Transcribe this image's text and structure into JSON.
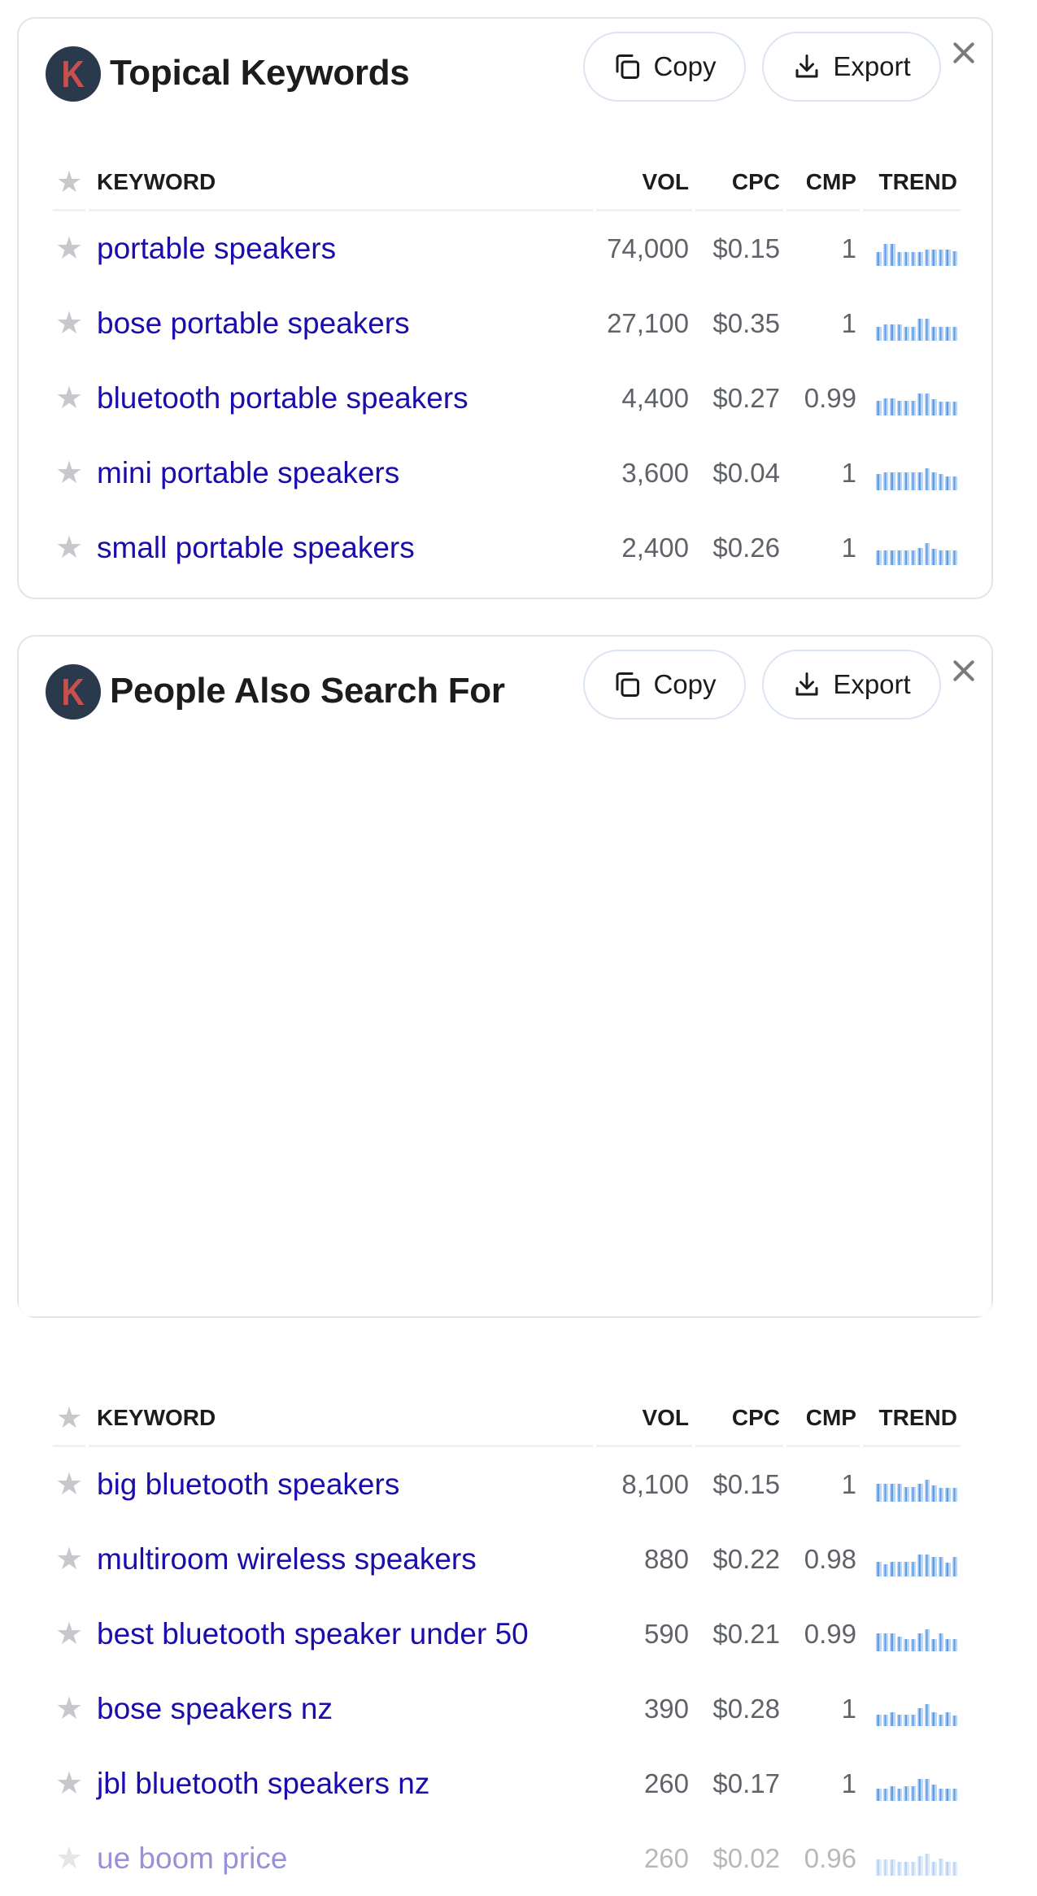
{
  "colors": {
    "link": "#1a0dab",
    "brand_bg": "#2a3a4c",
    "brand_letter": "#c9504c",
    "trend_bar": "#5f9ee6"
  },
  "icons": {
    "star": "star-icon",
    "copy": "copy-icon",
    "export": "download-icon",
    "close": "close-icon",
    "logo": "keywords-everywhere-logo"
  },
  "logo_letter": "K",
  "cards": [
    {
      "title": "Topical Keywords",
      "copy_label": "Copy",
      "export_label": "Export",
      "columns": {
        "keyword": "KEYWORD",
        "vol": "VOL",
        "cpc": "CPC",
        "cmp": "CMP",
        "trend": "TREND"
      },
      "rows": [
        {
          "keyword": "portable speakers",
          "vol": "74,000",
          "cpc": "$0.15",
          "cmp": "1",
          "trend": [
            0.6,
            0.95,
            0.95,
            0.6,
            0.6,
            0.6,
            0.6,
            0.7,
            0.7,
            0.7,
            0.7,
            0.65
          ]
        },
        {
          "keyword": "bose portable speakers",
          "vol": "27,100",
          "cpc": "$0.35",
          "cmp": "1",
          "trend": [
            0.6,
            0.7,
            0.7,
            0.7,
            0.6,
            0.6,
            0.95,
            0.95,
            0.6,
            0.6,
            0.6,
            0.6
          ]
        },
        {
          "keyword": "bluetooth portable speakers",
          "vol": "4,400",
          "cpc": "$0.27",
          "cmp": "0.99",
          "trend": [
            0.65,
            0.75,
            0.75,
            0.65,
            0.65,
            0.65,
            0.95,
            0.95,
            0.7,
            0.6,
            0.6,
            0.6
          ]
        },
        {
          "keyword": "mini portable speakers",
          "vol": "3,600",
          "cpc": "$0.04",
          "cmp": "1",
          "trend": [
            0.7,
            0.8,
            0.8,
            0.8,
            0.8,
            0.8,
            0.8,
            0.95,
            0.8,
            0.7,
            0.6,
            0.6
          ]
        },
        {
          "keyword": "small portable speakers",
          "vol": "2,400",
          "cpc": "$0.26",
          "cmp": "1",
          "trend": [
            0.65,
            0.65,
            0.65,
            0.65,
            0.65,
            0.65,
            0.75,
            0.95,
            0.7,
            0.65,
            0.65,
            0.65
          ]
        }
      ]
    },
    {
      "title": "People Also Search For",
      "copy_label": "Copy",
      "export_label": "Export",
      "columns": {
        "keyword": "KEYWORD",
        "vol": "VOL",
        "cpc": "CPC",
        "cmp": "CMP",
        "trend": "TREND"
      },
      "rows": [
        {
          "keyword": "big bluetooth speakers",
          "vol": "8,100",
          "cpc": "$0.15",
          "cmp": "1",
          "trend": [
            0.8,
            0.8,
            0.8,
            0.8,
            0.65,
            0.65,
            0.8,
            0.95,
            0.7,
            0.6,
            0.6,
            0.6
          ]
        },
        {
          "keyword": "multiroom wireless speakers",
          "vol": "880",
          "cpc": "$0.22",
          "cmp": "0.98",
          "trend": [
            0.65,
            0.55,
            0.65,
            0.65,
            0.65,
            0.65,
            0.95,
            0.95,
            0.85,
            0.85,
            0.6,
            0.85
          ]
        },
        {
          "keyword": "best bluetooth speaker under 50",
          "vol": "590",
          "cpc": "$0.21",
          "cmp": "0.99",
          "trend": [
            0.8,
            0.8,
            0.8,
            0.65,
            0.55,
            0.55,
            0.8,
            0.95,
            0.55,
            0.8,
            0.55,
            0.55
          ]
        },
        {
          "keyword": "bose speakers nz",
          "vol": "390",
          "cpc": "$0.28",
          "cmp": "1",
          "trend": [
            0.5,
            0.5,
            0.6,
            0.5,
            0.5,
            0.5,
            0.8,
            0.95,
            0.6,
            0.5,
            0.6,
            0.45
          ]
        },
        {
          "keyword": "jbl bluetooth speakers nz",
          "vol": "260",
          "cpc": "$0.17",
          "cmp": "1",
          "trend": [
            0.55,
            0.55,
            0.65,
            0.55,
            0.65,
            0.65,
            0.95,
            0.95,
            0.7,
            0.55,
            0.55,
            0.55
          ]
        },
        {
          "keyword": "ue boom price",
          "vol": "260",
          "cpc": "$0.02",
          "cmp": "0.96",
          "trend": [
            0.7,
            0.7,
            0.7,
            0.6,
            0.6,
            0.6,
            0.85,
            0.95,
            0.6,
            0.75,
            0.6,
            0.6
          ]
        }
      ]
    }
  ]
}
